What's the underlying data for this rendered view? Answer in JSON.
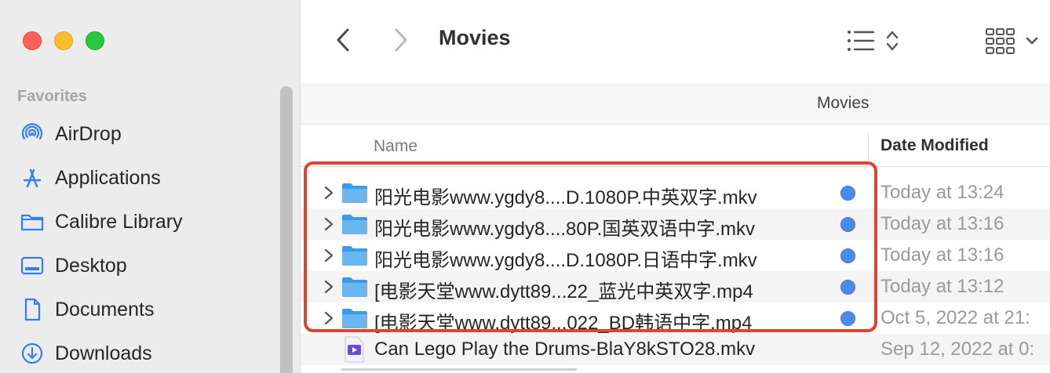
{
  "window": {
    "title": "Movies",
    "traffic_lights": [
      "close",
      "minimize",
      "zoom"
    ]
  },
  "sidebar": {
    "section_label": "Favorites",
    "items": [
      {
        "label": "AirDrop",
        "icon": "airdrop-icon"
      },
      {
        "label": "Applications",
        "icon": "applications-icon"
      },
      {
        "label": "Calibre Library",
        "icon": "folder-icon"
      },
      {
        "label": "Desktop",
        "icon": "desktop-icon"
      },
      {
        "label": "Documents",
        "icon": "document-icon"
      },
      {
        "label": "Downloads",
        "icon": "downloads-icon"
      }
    ]
  },
  "toolbar": {
    "back_icon": "chevron-left-icon",
    "forward_icon": "chevron-right-icon",
    "list_view_icon": "list-view-icon",
    "group_icon": "grid-view-icon"
  },
  "pathbar": {
    "label": "Movies"
  },
  "columns": {
    "name": "Name",
    "date_modified": "Date Modified"
  },
  "files": [
    {
      "name": "阳光电影www.ygdy8....D.1080P.中英双字.mkv",
      "date": "Today at 13:24",
      "type": "folder",
      "tag": "blue"
    },
    {
      "name": "阳光电影www.ygdy8....80P.国英双语中字.mkv",
      "date": "Today at 13:16",
      "type": "folder",
      "tag": "blue"
    },
    {
      "name": "阳光电影www.ygdy8....D.1080P.日语中字.mkv",
      "date": "Today at 13:16",
      "type": "folder",
      "tag": "blue"
    },
    {
      "name": "[电影天堂www.dytt89...22_蓝光中英双字.mp4",
      "date": "Today at 13:12",
      "type": "folder",
      "tag": "blue"
    },
    {
      "name": "[电影天堂www.dytt89...022_BD韩语中字.mp4",
      "date": "Oct 5, 2022 at 21:",
      "type": "folder",
      "tag": "blue"
    },
    {
      "name": "Can Lego Play the Drums-BlaY8kSTO28.mkv",
      "date": "Sep 12, 2022 at 0:",
      "type": "video-file",
      "tag": ""
    }
  ],
  "colors": {
    "tag_blue": "#4c8af0",
    "highlight_red": "#e0432e",
    "accent": "#2f7ef5",
    "folder_blue": "#6cb6f0"
  }
}
